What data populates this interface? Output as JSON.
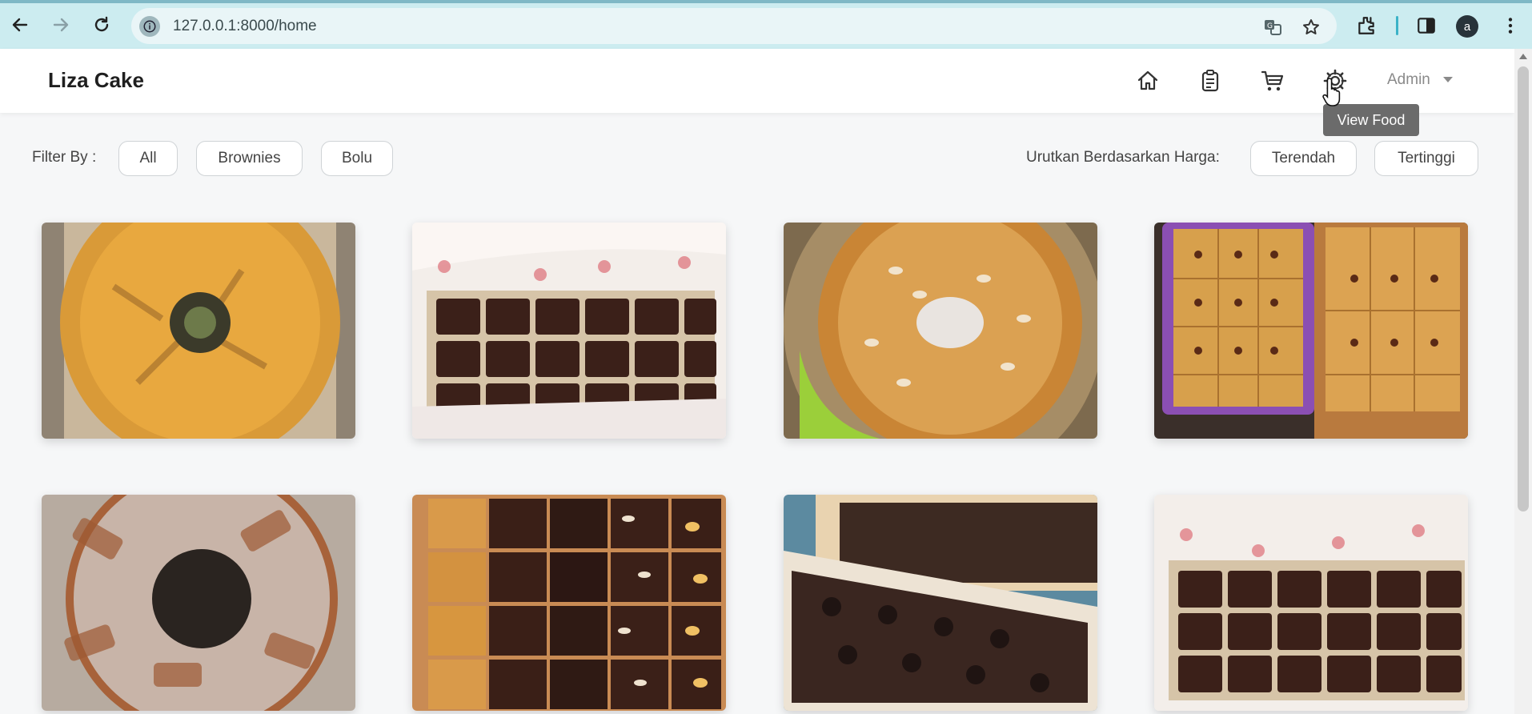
{
  "browser": {
    "url": "127.0.0.1:8000/home",
    "profile_initial": "a",
    "icons": [
      "back-icon",
      "forward-icon",
      "reload-icon",
      "site-info-icon",
      "translate-icon",
      "star-icon",
      "extensions-icon",
      "side-panel-icon",
      "menu-icon"
    ]
  },
  "app": {
    "brand": "Liza Cake",
    "nav_icons": [
      "home-icon",
      "clipboard-icon",
      "cart-icon",
      "gear-icon"
    ],
    "admin_label": "Admin",
    "tooltip": "View Food"
  },
  "filters": {
    "label": "Filter By :",
    "options": [
      "All",
      "Brownies",
      "Bolu"
    ],
    "sort_label": "Urutkan Berdasarkan Harga:",
    "sort_options": [
      "Terendah",
      "Tertinggi"
    ]
  },
  "products": [
    {
      "image": "marble-bundt-cake"
    },
    {
      "image": "brownies-box"
    },
    {
      "image": "almond-ring-cake"
    },
    {
      "image": "raisin-bars-trays"
    },
    {
      "image": "sugared-bundt-cake"
    },
    {
      "image": "assorted-topping-brownies"
    },
    {
      "image": "cookie-brownies-tray"
    },
    {
      "image": "brownies-box-2"
    }
  ],
  "colors": {
    "chrome_bg": "#ccecf0",
    "page_bg": "#f6f7f8",
    "tooltip_bg": "#6b6b6b"
  }
}
